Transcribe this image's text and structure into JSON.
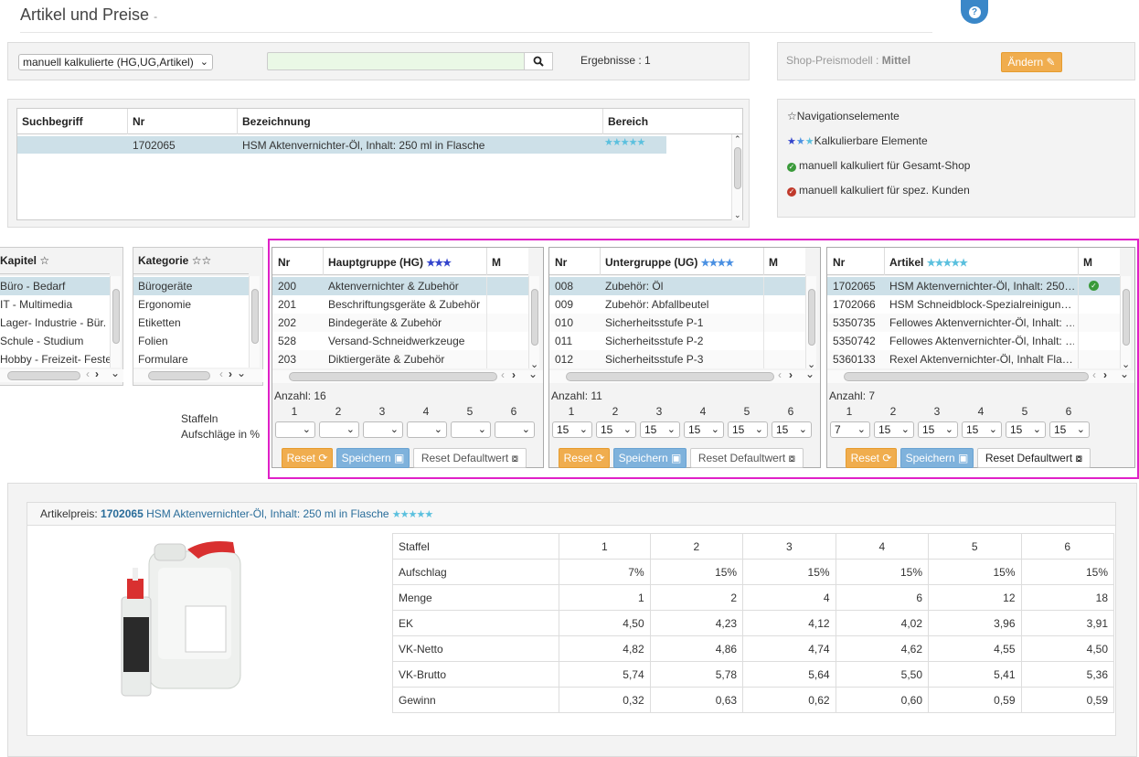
{
  "header": {
    "title": "Artikel und Preise",
    "title_suffix": "-",
    "help_icon": "question-icon"
  },
  "search": {
    "dropdown_value": "manuell kalkulierte (HG,UG,Artikel)",
    "input_value": "",
    "results_label": "Ergebnisse : 1"
  },
  "shop": {
    "label": "Shop-Preismodell :",
    "value": "Mittel",
    "button": "Ändern"
  },
  "results_table": {
    "columns": [
      "Suchbegriff",
      "Nr",
      "Bezeichnung",
      "Bereich"
    ],
    "rows": [
      {
        "suchbegriff": "",
        "nr": "1702065",
        "bezeichnung": "HSM Aktenvernichter-Öl, Inhalt: 250 ml in Flasche",
        "bereich": "★★★★★"
      }
    ]
  },
  "legend": {
    "items": [
      {
        "icon": "☆",
        "text": "Navigationselemente"
      },
      {
        "icon": "★★★",
        "text": "Kalkulierbare Elemente"
      },
      {
        "icon": "check-green-icon",
        "text": "manuell kalkuliert für Gesamt-Shop"
      },
      {
        "icon": "check-red-icon",
        "text": "manuell kalkuliert für spez. Kunden"
      }
    ]
  },
  "kapitel": {
    "header": "Kapitel",
    "star": "☆",
    "items": [
      "Büro - Bedarf",
      "IT - Multimedia",
      "Lager- Industrie - Bür.",
      "Schule - Studium",
      "Hobby - Freizeit- Feste"
    ]
  },
  "kategorie": {
    "header": "Kategorie",
    "star": "☆☆",
    "items": [
      "Bürogeräte",
      "Ergonomie",
      "Etiketten",
      "Folien",
      "Formulare"
    ]
  },
  "staffeln": {
    "label1": "Staffeln",
    "label2": "Aufschläge in %"
  },
  "hg": {
    "col_nr": "Nr",
    "col_name": "Hauptgruppe (HG)",
    "stars": "★★★",
    "col_m": "M",
    "rows": [
      [
        "200",
        "Aktenvernichter & Zubehör"
      ],
      [
        "201",
        "Beschriftungsgeräte & Zubehör"
      ],
      [
        "202",
        "Bindegeräte & Zubehör"
      ],
      [
        "528",
        "Versand-Schneidwerkzeuge"
      ],
      [
        "203",
        "Diktiergeräte & Zubehör"
      ]
    ],
    "anzahl": "Anzahl: 16",
    "staffel_nums": [
      "1",
      "2",
      "3",
      "4",
      "5",
      "6"
    ],
    "selects": [
      "",
      "",
      "",
      "",
      "",
      ""
    ],
    "reset": "Reset",
    "save": "Speichern",
    "reset_default": "Reset Defaultwert"
  },
  "ug": {
    "col_nr": "Nr",
    "col_name": "Untergruppe (UG)",
    "stars": "★★★★",
    "col_m": "M",
    "rows": [
      [
        "008",
        "Zubehör: Öl"
      ],
      [
        "009",
        "Zubehör: Abfallbeutel"
      ],
      [
        "010",
        "Sicherheitsstufe P-1"
      ],
      [
        "011",
        "Sicherheitsstufe P-2"
      ],
      [
        "012",
        "Sicherheitsstufe P-3"
      ]
    ],
    "anzahl": "Anzahl: 11",
    "staffel_nums": [
      "1",
      "2",
      "3",
      "4",
      "5",
      "6"
    ],
    "selects": [
      "15",
      "15",
      "15",
      "15",
      "15",
      "15"
    ],
    "reset": "Reset",
    "save": "Speichern",
    "reset_default": "Reset Defaultwert"
  },
  "art": {
    "col_nr": "Nr",
    "col_name": "Artikel",
    "stars": "★★★★★",
    "col_m": "M",
    "rows": [
      [
        "1702065",
        "HSM Aktenvernichter-Öl, Inhalt: 250…"
      ],
      [
        "1702066",
        "HSM Schneidblock-Spezialreinigun…"
      ],
      [
        "5350735",
        "Fellowes Aktenvernichter-Öl, Inhalt: …"
      ],
      [
        "5350742",
        "Fellowes Aktenvernichter-Öl, Inhalt: …"
      ],
      [
        "5360133",
        "Rexel Aktenvernichter-Öl, Inhalt Fla…"
      ]
    ],
    "anzahl": "Anzahl: 7",
    "staffel_nums": [
      "1",
      "2",
      "3",
      "4",
      "5",
      "6"
    ],
    "selects": [
      "7",
      "15",
      "15",
      "15",
      "15",
      "15"
    ],
    "reset": "Reset",
    "save": "Speichern",
    "reset_default": "Reset Defaultwert"
  },
  "price": {
    "label": "Artikelpreis:",
    "nr": "1702065",
    "name": "HSM Aktenvernichter-Öl, Inhalt: 250 ml in Flasche",
    "stars": "★★★★★",
    "table": [
      [
        "Staffel",
        "1",
        "2",
        "3",
        "4",
        "5",
        "6"
      ],
      [
        "Aufschlag",
        "7%",
        "15%",
        "15%",
        "15%",
        "15%",
        "15%"
      ],
      [
        "Menge",
        "1",
        "2",
        "4",
        "6",
        "12",
        "18"
      ],
      [
        "EK",
        "4,50",
        "4,23",
        "4,12",
        "4,02",
        "3,96",
        "3,91"
      ],
      [
        "VK-Netto",
        "4,82",
        "4,86",
        "4,74",
        "4,62",
        "4,55",
        "4,50"
      ],
      [
        "VK-Brutto",
        "5,74",
        "5,78",
        "5,64",
        "5,50",
        "5,41",
        "5,36"
      ],
      [
        "Gewinn",
        "0,32",
        "0,63",
        "0,62",
        "0,60",
        "0,59",
        "0,59"
      ]
    ]
  },
  "colors": {
    "highlight": "#e020c8",
    "orange": "#f0ad4e",
    "blue": "#7fb2dc",
    "link": "#2a6d9a",
    "selected_row": "#cde0e8"
  }
}
